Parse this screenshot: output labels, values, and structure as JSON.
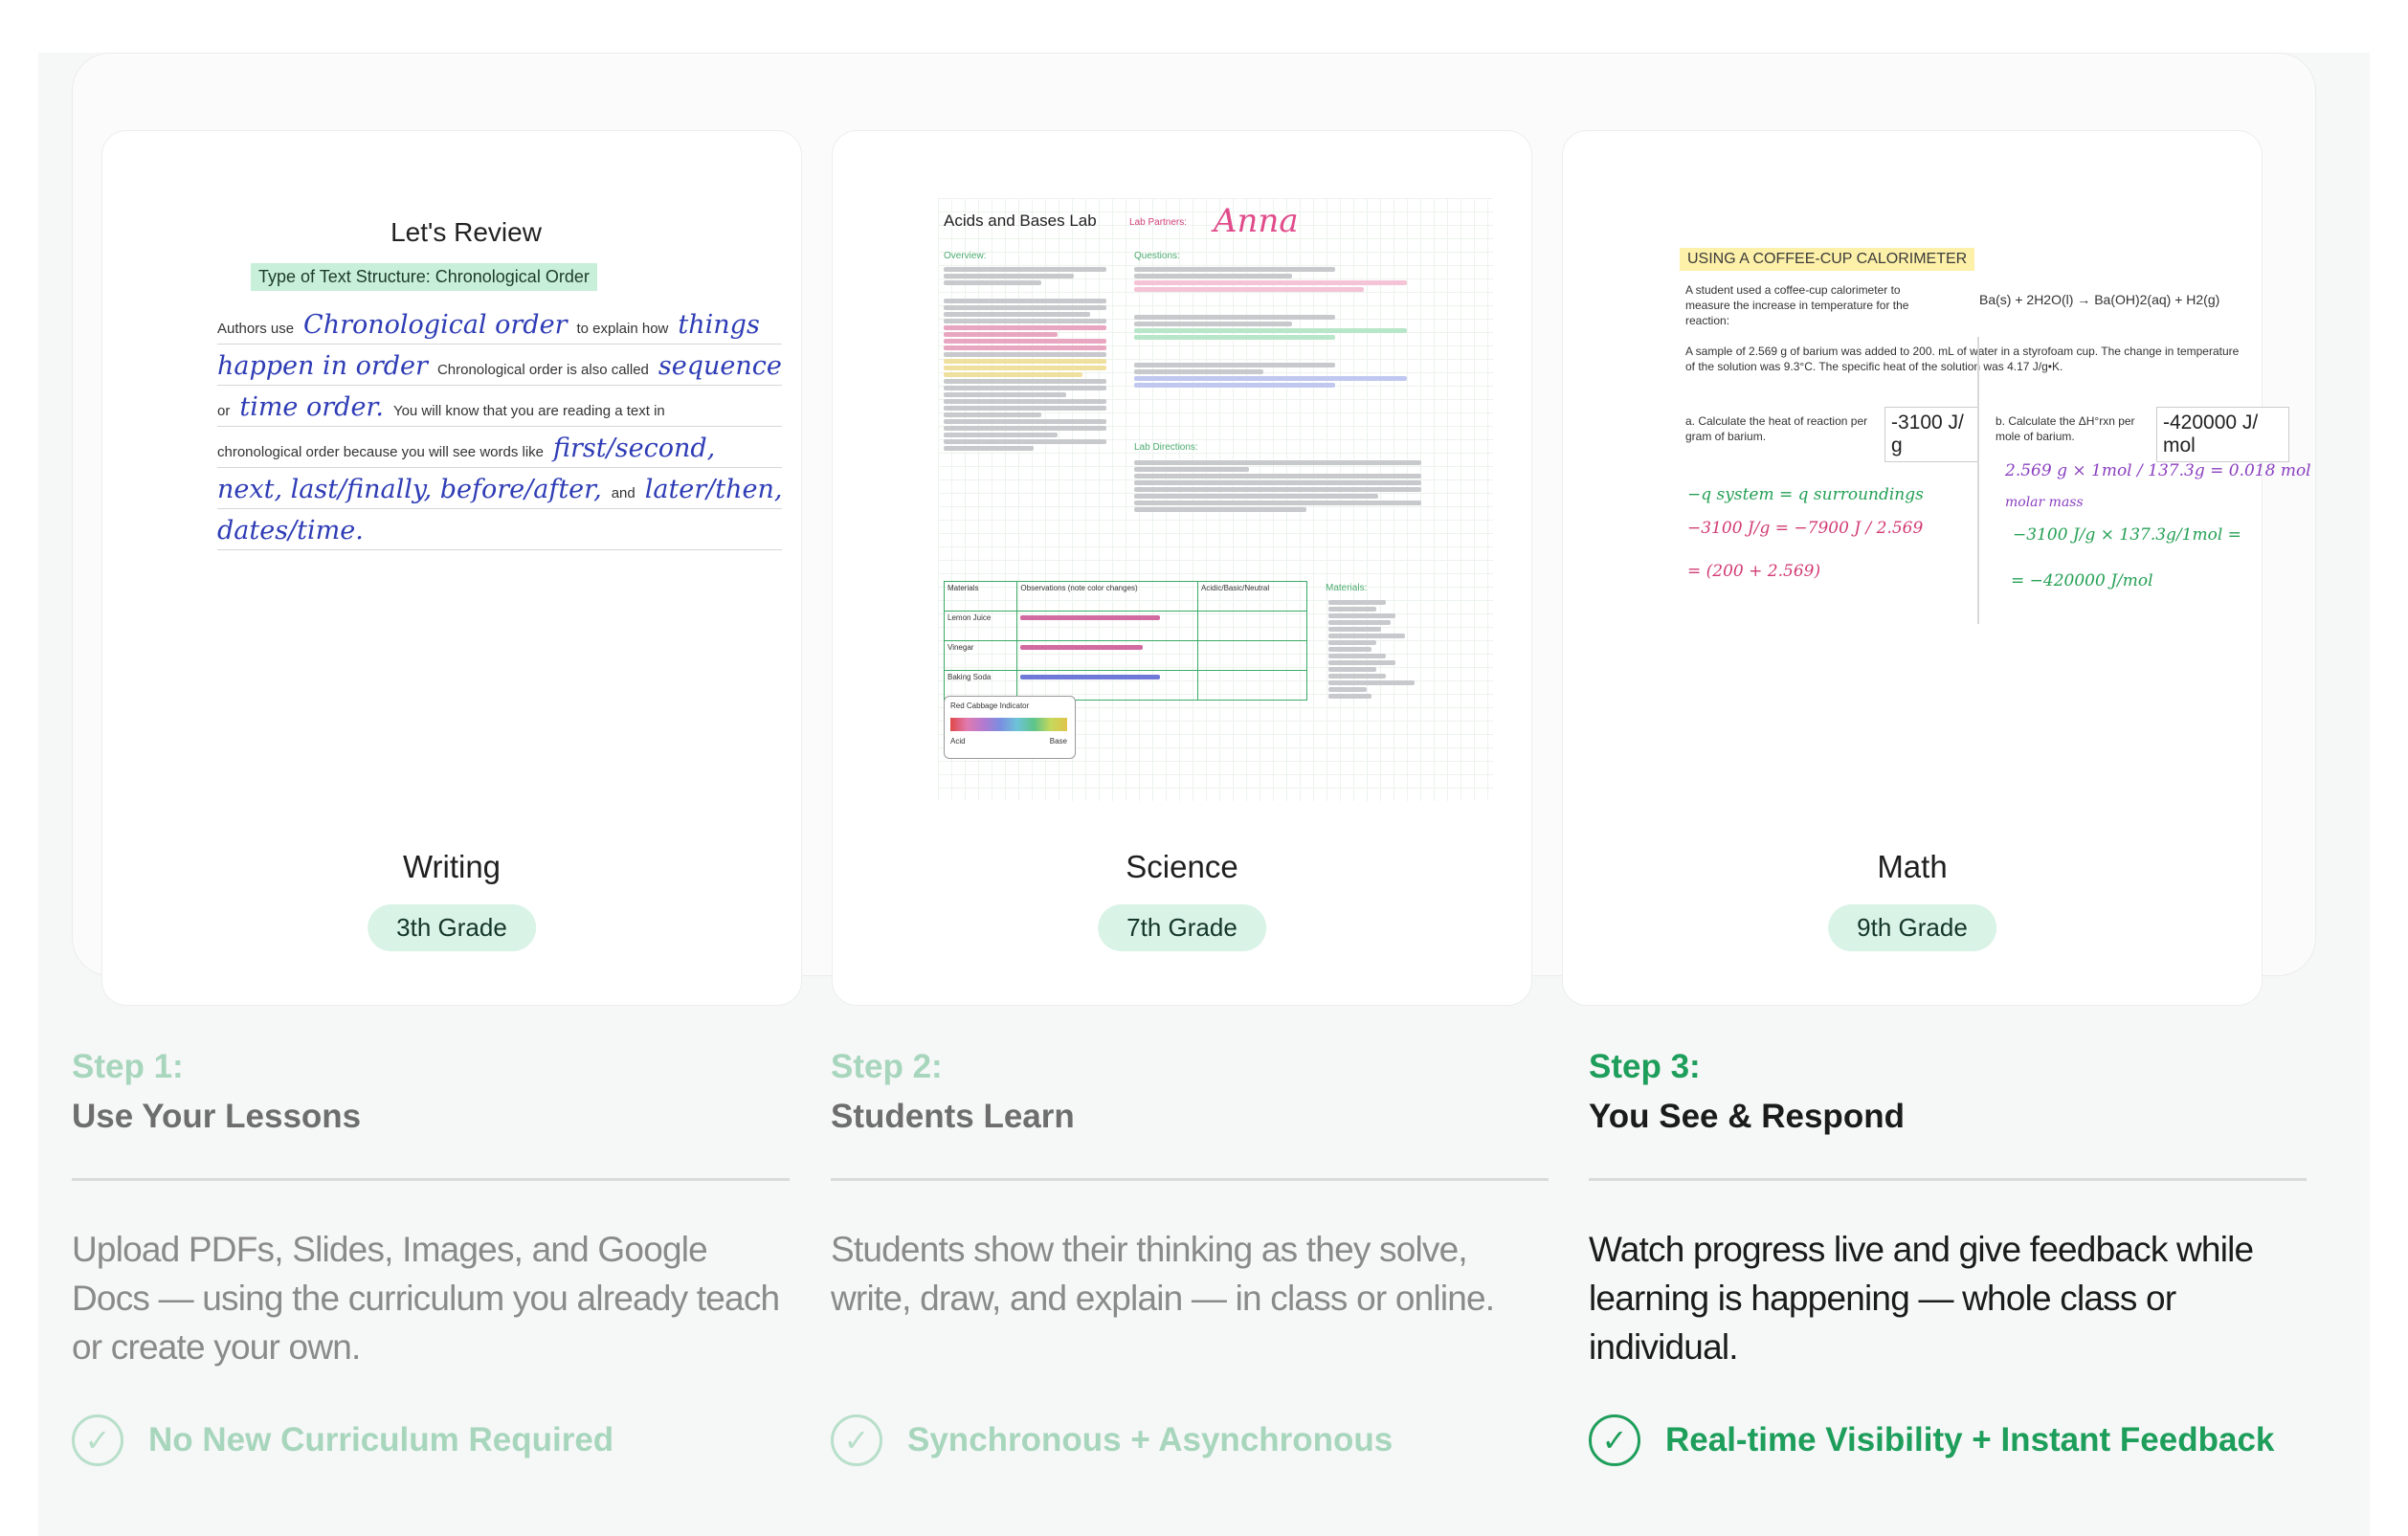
{
  "cards": [
    {
      "subject": "Writing",
      "grade": "3th Grade",
      "preview": {
        "heading": "Let's Review",
        "subheading": "Type of Text Structure: Chronological Order",
        "lines": [
          [
            {
              "t": "Authors use",
              "h": false
            },
            {
              "t": "Chronological order",
              "h": true
            },
            {
              "t": "to explain how",
              "h": false
            },
            {
              "t": "things",
              "h": true
            }
          ],
          [
            {
              "t": "happen in order",
              "h": true
            },
            {
              "t": "Chronological order is also called",
              "h": false
            },
            {
              "t": "sequence",
              "h": true
            }
          ],
          [
            {
              "t": "or",
              "h": false
            },
            {
              "t": "time order.",
              "h": true
            },
            {
              "t": "You will know that you are reading a text in",
              "h": false
            }
          ],
          [
            {
              "t": "chronological order because you will see words like",
              "h": false
            },
            {
              "t": "first/second,",
              "h": true
            }
          ],
          [
            {
              "t": "next, last/finally, before/after,",
              "h": true
            },
            {
              "t": "and",
              "h": false
            },
            {
              "t": "later/then,",
              "h": true
            }
          ],
          [
            {
              "t": "dates/time.",
              "h": true
            }
          ]
        ]
      }
    },
    {
      "subject": "Science",
      "grade": "7th Grade",
      "preview": {
        "title": "Acids and Bases Lab",
        "partners_label": "Lab Partners:",
        "partner_name": "Anna",
        "overview_label": "Overview:",
        "questions_label": "Questions:",
        "directions_label": "Lab Directions:",
        "materials_label": "Materials:",
        "table_headers": [
          "Materials",
          "Observations (note color changes)",
          "Acidic/Basic/Neutral"
        ],
        "table_rows": [
          "Lemon Juice",
          "Vinegar",
          "Baking Soda"
        ],
        "indicator_label": "Red Cabbage Indicator",
        "indicator_acid": "Acid",
        "indicator_base": "Base"
      }
    },
    {
      "subject": "Math",
      "grade": "9th Grade",
      "preview": {
        "heading": "USING A COFFEE-CUP CALORIMETER",
        "intro": "A student used a coffee-cup calorimeter to measure the increase in temperature for the reaction:",
        "equation": "Ba(s) + 2H2O(l) → Ba(OH)2(aq) + H2(g)",
        "problem": "A sample of 2.569 g of barium was added to 200. mL of water in a styrofoam cup. The change in temperature of the solution was 9.3°C. The specific heat of the solution was 4.17 J/g•K.",
        "part_a": "a. Calculate the heat of reaction per gram of barium.",
        "answer_a": "-3100 J/ g",
        "part_b": "b. Calculate the ΔH°rxn per mole of barium.",
        "answer_b": "-420000 J/ mol"
      }
    }
  ],
  "steps": [
    {
      "number": "Step 1:",
      "title": "Use Your Lessons",
      "description": "Upload PDFs, Slides, Images, and Google Docs — using the curriculum you already teach or create your own.",
      "feature": "No New Curriculum Required",
      "active": false
    },
    {
      "number": "Step 2:",
      "title": "Students Learn",
      "description": "Students show their thinking as they solve, write, draw, and explain — in class or online.",
      "feature": "Synchronous + Asynchronous",
      "active": false
    },
    {
      "number": "Step 3:",
      "title": "You See & Respond",
      "description": "Watch progress live and give feedback while learning is happening — whole class or individual.",
      "feature": "Real-time Visibility + Instant Feedback",
      "active": true
    }
  ],
  "colors": {
    "accent_green": "#1e9e5b",
    "muted_green": "#a7d6bd",
    "badge_bg": "#d9f3e6"
  }
}
